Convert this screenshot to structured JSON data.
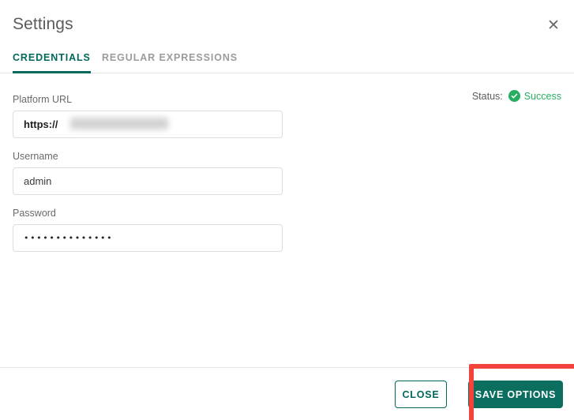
{
  "dialog": {
    "title": "Settings",
    "close_icon": "close-icon",
    "close_glyph": "✕"
  },
  "tabs": [
    {
      "label": "CREDENTIALS",
      "active": true
    },
    {
      "label": "REGULAR EXPRESSIONS",
      "active": false
    }
  ],
  "status": {
    "label": "Status:",
    "value": "Success",
    "icon": "check-circle-icon",
    "color": "#27ae60"
  },
  "fields": {
    "platform_url": {
      "label": "Platform URL",
      "value_visible": "https://",
      "value_redacted": true,
      "placeholder": ""
    },
    "username": {
      "label": "Username",
      "value": "admin",
      "placeholder": ""
    },
    "password": {
      "label": "Password",
      "value_masked": "••••••••••••••",
      "placeholder": ""
    }
  },
  "footer": {
    "close_label": "CLOSE",
    "save_label": "SAVE OPTIONS"
  },
  "colors": {
    "accent": "#00695c",
    "save_button": "#0b6e5f",
    "success": "#27ae60",
    "annotation": "#f4433a"
  }
}
